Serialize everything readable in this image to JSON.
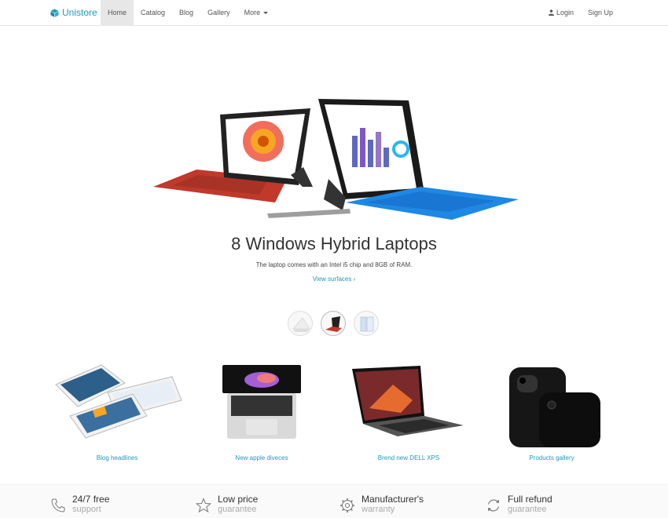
{
  "brand": {
    "name": "Unistore"
  },
  "nav": {
    "items": [
      {
        "label": "Home"
      },
      {
        "label": "Catalog"
      },
      {
        "label": "Blog"
      },
      {
        "label": "Gallery"
      },
      {
        "label": "More"
      }
    ],
    "login": "Login",
    "signup": "Sign Up"
  },
  "hero": {
    "title": "8 Windows Hybrid Laptops",
    "subtitle": "The laptop comes with an Intel i5 chip and 8GB of RAM.",
    "link": "View surfaces ›"
  },
  "features": [
    {
      "caption": "Blog headlines"
    },
    {
      "caption": "New apple diveces"
    },
    {
      "caption": "Brend new DELL XPS"
    },
    {
      "caption": "Products gallery"
    }
  ],
  "services": [
    {
      "title": "24/7 free",
      "sub": "support",
      "icon": "phone-icon"
    },
    {
      "title": "Low price",
      "sub": "guarantee",
      "icon": "star-icon"
    },
    {
      "title": "Manufacturer's",
      "sub": "warranty",
      "icon": "gear-icon"
    },
    {
      "title": "Full refund",
      "sub": "guarantee",
      "icon": "refresh-icon"
    }
  ],
  "colors": {
    "accent": "#1a9bbf",
    "nav_active_bg": "#e7e7e7"
  }
}
